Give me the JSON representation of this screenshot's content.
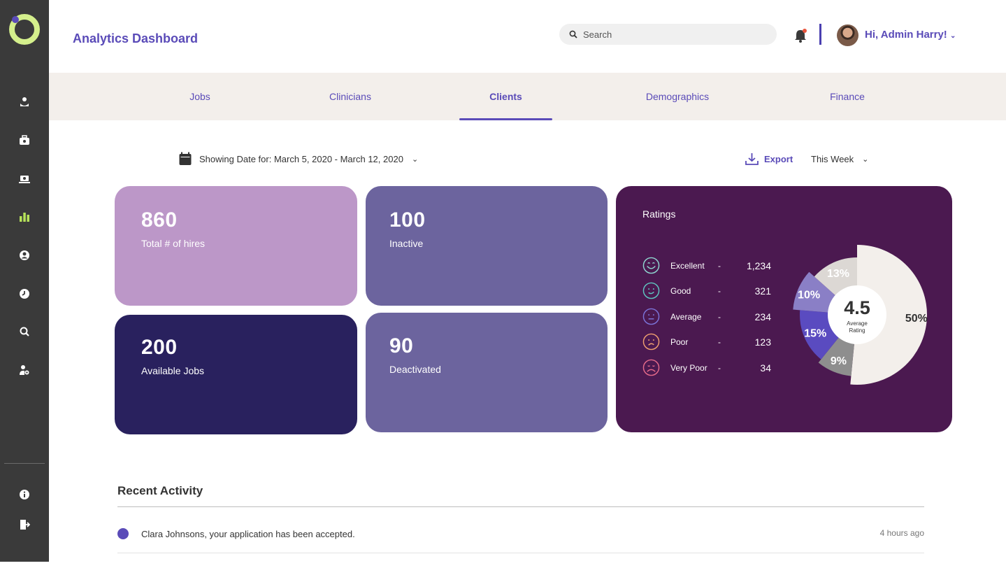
{
  "header": {
    "title": "Analytics Dashboard",
    "search_placeholder": "Search",
    "greeting": "Hi, Admin Harry!"
  },
  "tabs": [
    {
      "label": "Jobs"
    },
    {
      "label": "Clinicians"
    },
    {
      "label": "Clients",
      "active": true
    },
    {
      "label": "Demographics"
    },
    {
      "label": "Finance"
    }
  ],
  "filters": {
    "date_label": "Showing Date for: March 5, 2020 - March 12, 2020",
    "export_label": "Export",
    "period": "This Week"
  },
  "stats": [
    {
      "value": "860",
      "label": "Total # of hires",
      "color": "#bc97c8"
    },
    {
      "value": "100",
      "label": "Inactive",
      "color": "#6c649e"
    },
    {
      "value": "200",
      "label": "Available Jobs",
      "color": "#29215e"
    },
    {
      "value": "90",
      "label": "Deactivated",
      "color": "#6c649e"
    }
  ],
  "ratings": {
    "title": "Ratings",
    "items": [
      {
        "name": "Excellent",
        "dash": "-",
        "value": "1,234",
        "icon": "excellent-face-icon",
        "color": "#8fd6d0"
      },
      {
        "name": "Good",
        "dash": "-",
        "value": "321",
        "icon": "good-face-icon",
        "color": "#5fc6c0"
      },
      {
        "name": "Average",
        "dash": "-",
        "value": "234",
        "icon": "average-face-icon",
        "color": "#7b74d8"
      },
      {
        "name": "Poor",
        "dash": "-",
        "value": "123",
        "icon": "poor-face-icon",
        "color": "#f0a070"
      },
      {
        "name": "Very Poor",
        "dash": "-",
        "value": "34",
        "icon": "very-poor-face-icon",
        "color": "#e56b8a"
      }
    ],
    "average": "4.5",
    "average_label_1": "Average",
    "average_label_2": "Rating"
  },
  "chart_data": {
    "type": "pie",
    "categories": [
      "50%",
      "9%",
      "15%",
      "10%",
      "13%"
    ],
    "values": [
      50,
      9,
      15,
      10,
      13
    ],
    "colors": [
      "#f3efeb",
      "#8e8e8e",
      "#5a4bc0",
      "#8a7fc6",
      "#dcd8d4"
    ],
    "labels": [
      "50%",
      "9%",
      "15%",
      "10%",
      "13%"
    ],
    "center_text": "4.5"
  },
  "recent": {
    "title": "Recent Activity",
    "items": [
      {
        "text": "Clara Johnsons, your application has been accepted.",
        "time": "4 hours ago"
      }
    ]
  },
  "colors": {
    "accent": "#5a4bb8",
    "sidebar": "#3a3a3a",
    "sidebar_active": "#b7e35a",
    "tabbar": "#f3efeb"
  }
}
